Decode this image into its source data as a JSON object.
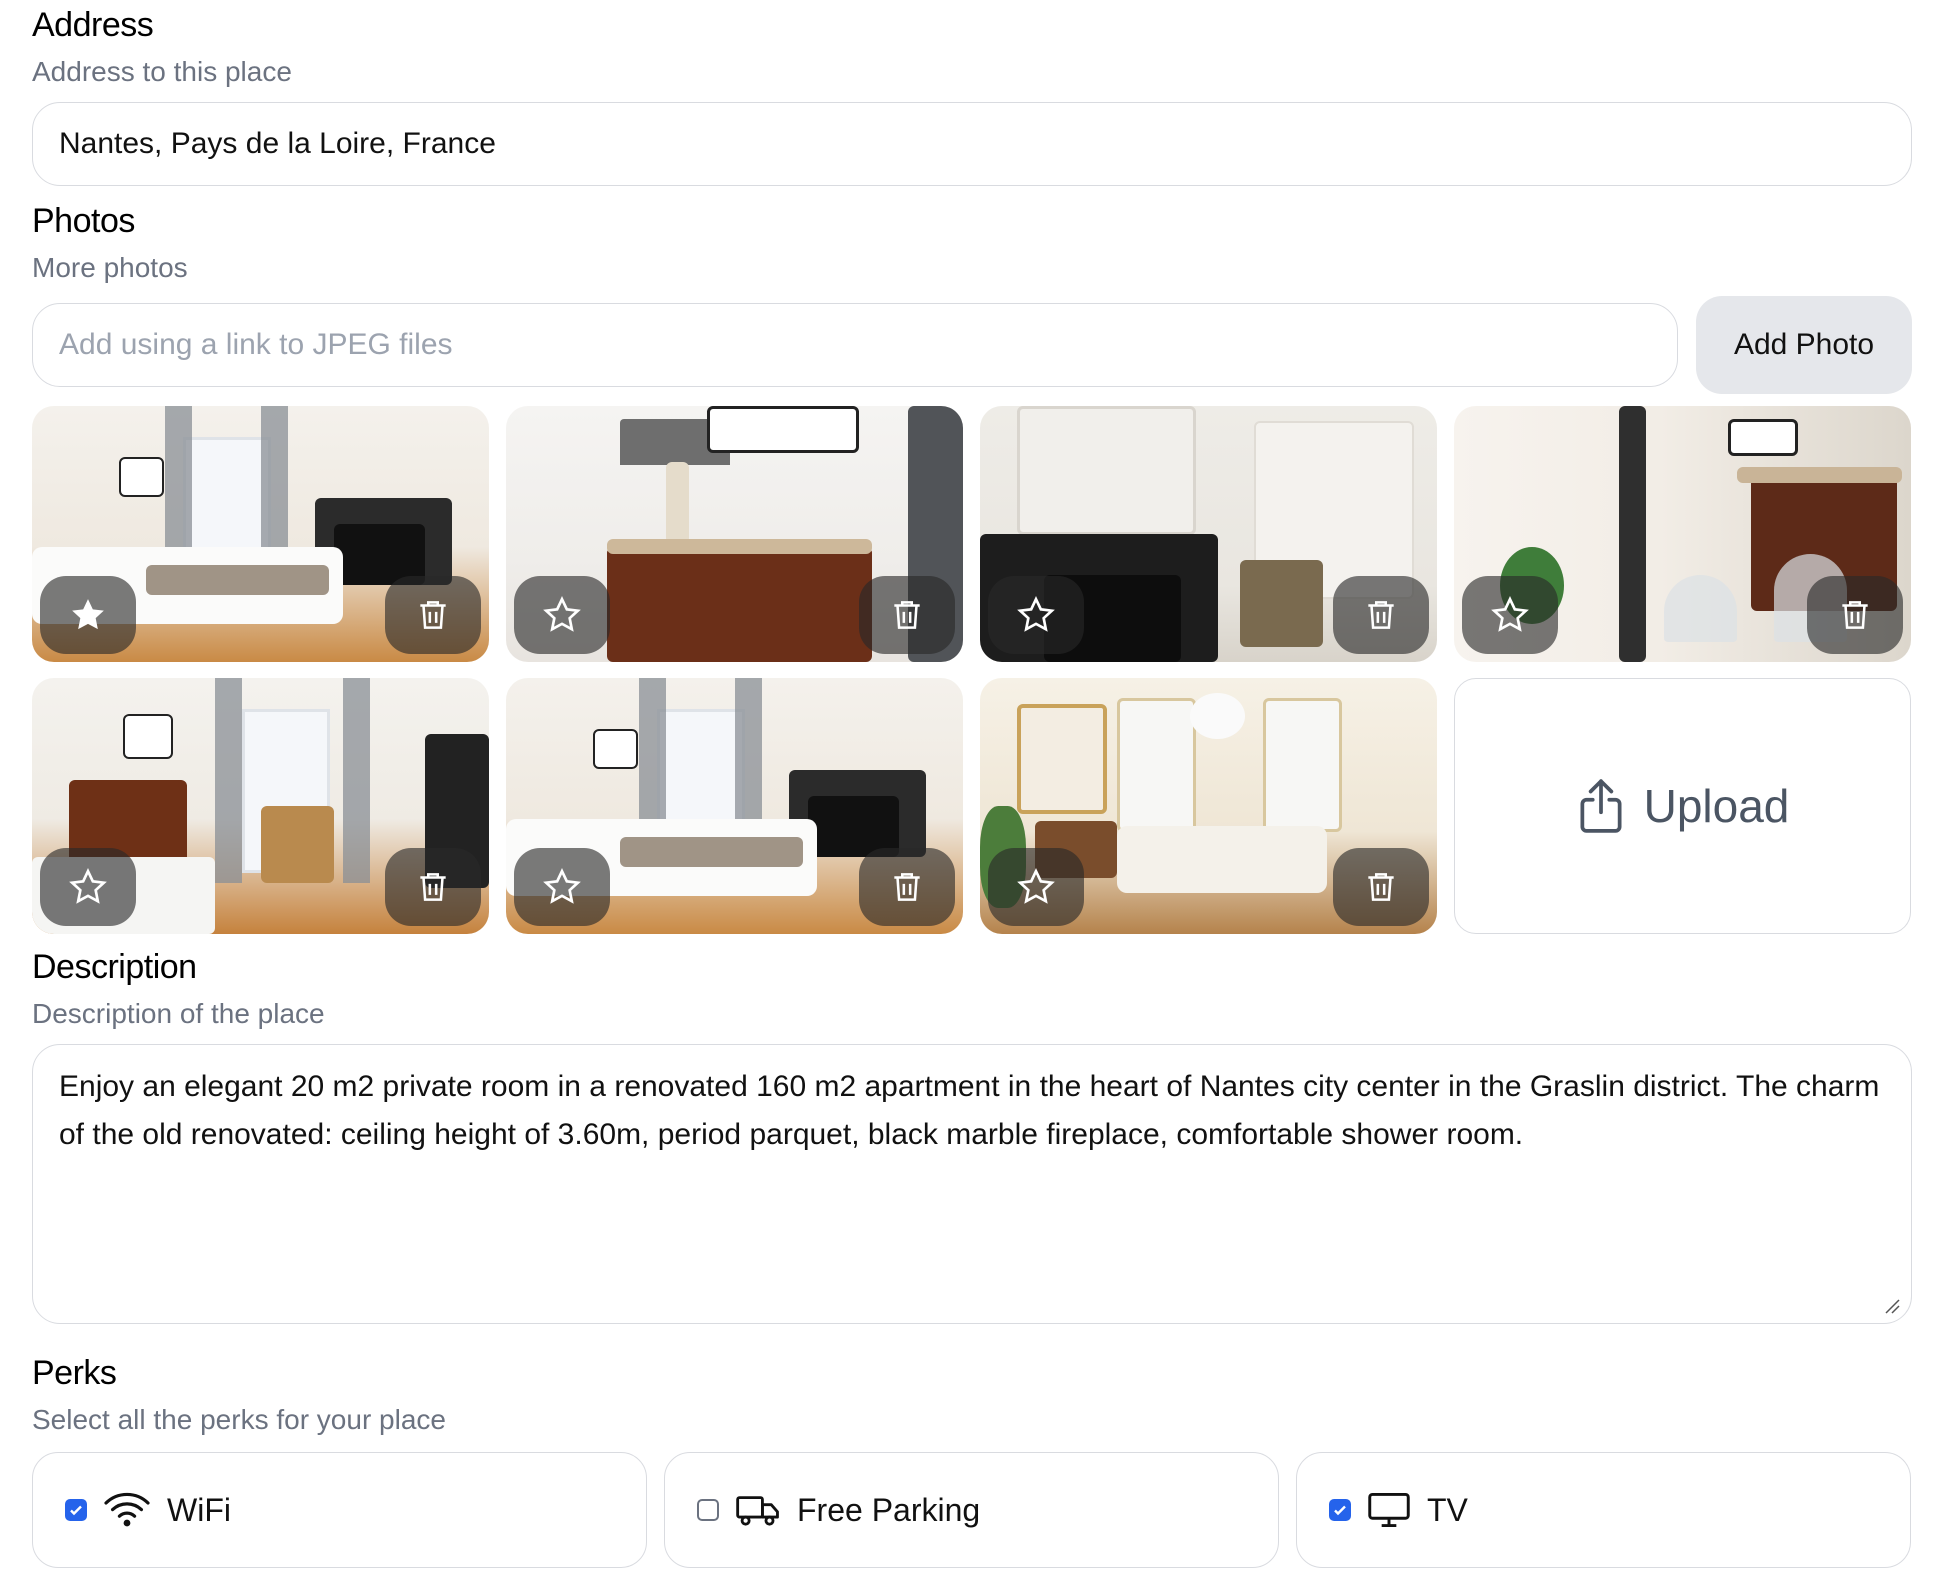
{
  "address": {
    "heading": "Address",
    "subheading": "Address to this place",
    "value": "Nantes, Pays de la Loire, France"
  },
  "photos": {
    "heading": "Photos",
    "subheading": "More photos",
    "placeholder": "Add using a link to JPEG files",
    "add_button": "Add Photo",
    "upload_label": "Upload",
    "items": [
      {
        "main": true
      },
      {
        "main": false
      },
      {
        "main": false
      },
      {
        "main": false
      },
      {
        "main": false
      },
      {
        "main": false
      },
      {
        "main": false
      }
    ]
  },
  "description": {
    "heading": "Description",
    "subheading": "Description of the place",
    "text": "Enjoy an elegant 20 m2 private room in a renovated 160 m2 apartment in the heart of Nantes city center in the Graslin district. The charm of the old renovated: ceiling height of 3.60m, period parquet, black marble fireplace, comfortable shower room."
  },
  "perks": {
    "heading": "Perks",
    "subheading": "Select all the perks for your place",
    "items": [
      {
        "label": "WiFi",
        "icon": "wifi-icon",
        "checked": true
      },
      {
        "label": "Free Parking",
        "icon": "truck-icon",
        "checked": false
      },
      {
        "label": "TV",
        "icon": "tv-icon",
        "checked": true
      }
    ]
  },
  "colors": {
    "accent": "#2563eb",
    "muted_text": "#6b7280",
    "border": "#d9dbe0",
    "button_bg": "#e5e7eb"
  }
}
